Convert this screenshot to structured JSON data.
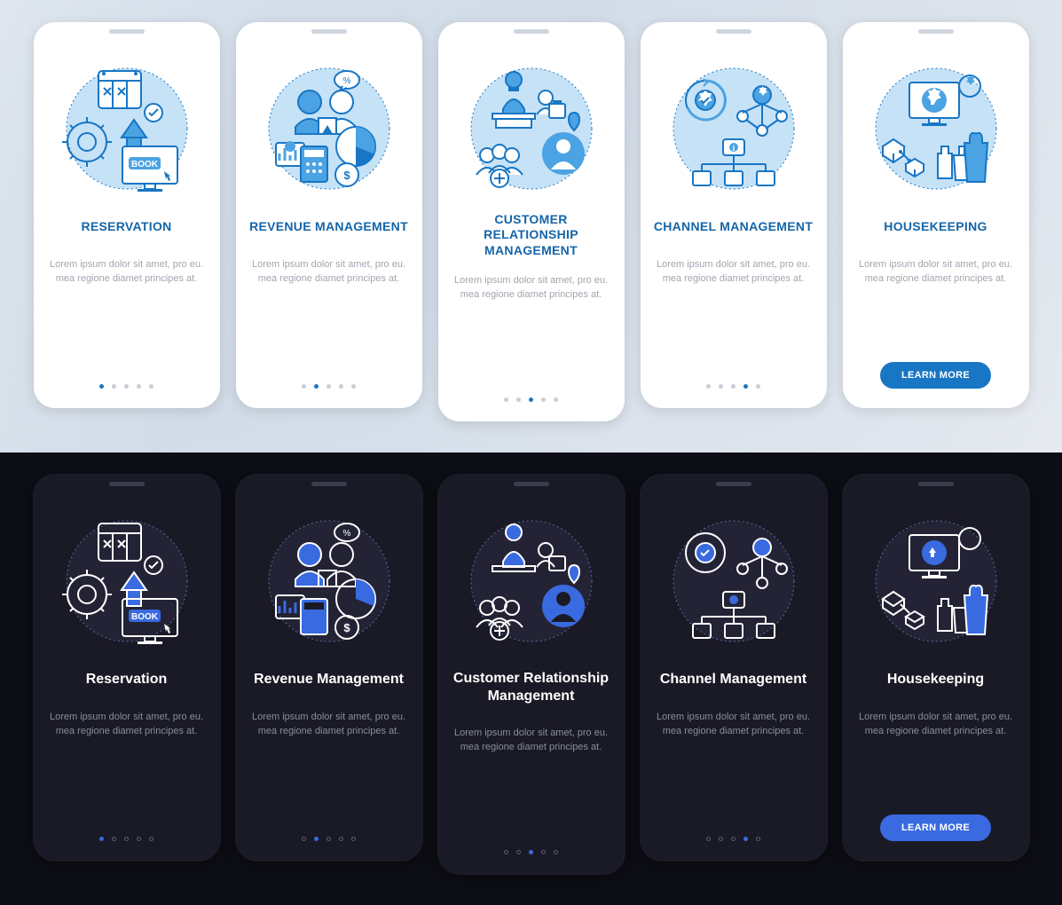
{
  "colors": {
    "light_accent": "#1876c4",
    "dark_accent": "#3a6ae0",
    "light_title": "#1565a8"
  },
  "cards": [
    {
      "title_light": "RESERVATION",
      "title_dark": "Reservation",
      "desc": "Lorem ipsum dolor sit amet, pro eu. mea regione diamet principes at.",
      "active_dot": 0,
      "has_button": false,
      "icon": "reservation"
    },
    {
      "title_light": "REVENUE MANAGEMENT",
      "title_dark": "Revenue Management",
      "desc": "Lorem ipsum dolor sit amet, pro eu. mea regione diamet principes at.",
      "active_dot": 1,
      "has_button": false,
      "icon": "revenue"
    },
    {
      "title_light": "CUSTOMER RELATIONSHIP MANAGEMENT",
      "title_dark": "Customer Relationship Management",
      "desc": "Lorem ipsum dolor sit amet, pro eu. mea regione diamet principes at.",
      "active_dot": 2,
      "has_button": false,
      "icon": "crm",
      "tall": true
    },
    {
      "title_light": "CHANNEL MANAGEMENT",
      "title_dark": "Channel Management",
      "desc": "Lorem ipsum dolor sit amet, pro eu. mea regione diamet principes at.",
      "active_dot": 3,
      "has_button": false,
      "icon": "channel"
    },
    {
      "title_light": "HOUSEKEEPING",
      "title_dark": "Housekeeping",
      "desc": "Lorem ipsum dolor sit amet, pro eu. mea regione diamet principes at.",
      "active_dot": 4,
      "has_button": true,
      "button_label": "LEARN MORE",
      "icon": "housekeeping"
    }
  ],
  "dot_count": 5
}
